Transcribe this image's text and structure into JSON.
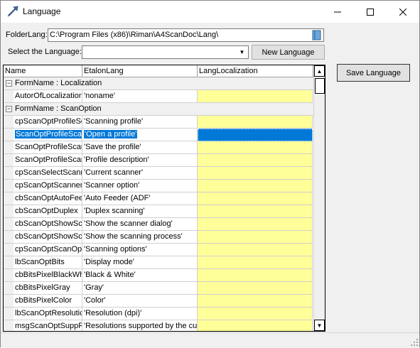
{
  "window": {
    "title": "Language",
    "icons": {
      "app": "arrow-app-icon",
      "minimize": "minimize-icon",
      "maximize": "maximize-icon",
      "close": "close-icon"
    }
  },
  "folder": {
    "label": "FolderLang:",
    "value": "C:\\Program Files (x86)\\Riman\\A4ScanDoc\\Lang\\",
    "icon": "folder-browse-icon"
  },
  "language": {
    "label": "Select the Language:",
    "value": "",
    "arrow_icon": "chevron-down-icon"
  },
  "buttons": {
    "new_language": "New Language",
    "save_language": "Save Language"
  },
  "grid": {
    "columns": [
      "Name",
      "EtalonLang",
      "LangLocalization"
    ],
    "groups": [
      {
        "label": "FormName : Localization",
        "expander": "−",
        "rows": [
          {
            "name": "AutorOfLocalization",
            "etalon": "'noname'",
            "localization": ""
          }
        ]
      },
      {
        "label": "FormName : ScanOption",
        "expander": "−",
        "rows": [
          {
            "name": "cpScanOptProfileSc",
            "etalon": "'Scanning profile'",
            "localization": ""
          },
          {
            "name": "ScanOptProfileScan",
            "etalon": "'Open a profile'",
            "localization": "",
            "selected": true
          },
          {
            "name": "ScanOptProfileScar",
            "etalon": "'Save the profile'",
            "localization": ""
          },
          {
            "name": "ScanOptProfileScar",
            "etalon": "'Profile description'",
            "localization": ""
          },
          {
            "name": "cpScanSelectScann",
            "etalon": "'Current scanner'",
            "localization": ""
          },
          {
            "name": "cpScanOptScanner",
            "etalon": "'Scanner option'",
            "localization": ""
          },
          {
            "name": "cbScanOptAutoFee",
            "etalon": "'Auto Feeder (ADF'",
            "localization": ""
          },
          {
            "name": "cbScanOptDuplex",
            "etalon": "'Duplex scanning'",
            "localization": ""
          },
          {
            "name": "cbScanOptShowSca",
            "etalon": "'Show the scanner dialog'",
            "localization": ""
          },
          {
            "name": "cbScanOptShowSca",
            "etalon": "'Show the scanning process'",
            "localization": ""
          },
          {
            "name": "cpScanOptScanOpt",
            "etalon": "'Scanning options'",
            "localization": ""
          },
          {
            "name": "lbScanOptBits",
            "etalon": "'Display mode'",
            "localization": ""
          },
          {
            "name": "cbBitsPixelBlackWhi",
            "etalon": "'Black & White'",
            "localization": ""
          },
          {
            "name": "cbBitsPixelGray",
            "etalon": "'Gray'",
            "localization": ""
          },
          {
            "name": "cbBitsPixelColor",
            "etalon": "'Color'",
            "localization": ""
          },
          {
            "name": "lbScanOptResolutic",
            "etalon": "'Resolution (dpi)'",
            "localization": ""
          },
          {
            "name": "msgScanOptSuppR",
            "etalon": "'Resolutions supported by the cu",
            "localization": ""
          }
        ]
      }
    ]
  },
  "colors": {
    "localization_bg": "#ffff99",
    "selection": "#0078d7"
  }
}
